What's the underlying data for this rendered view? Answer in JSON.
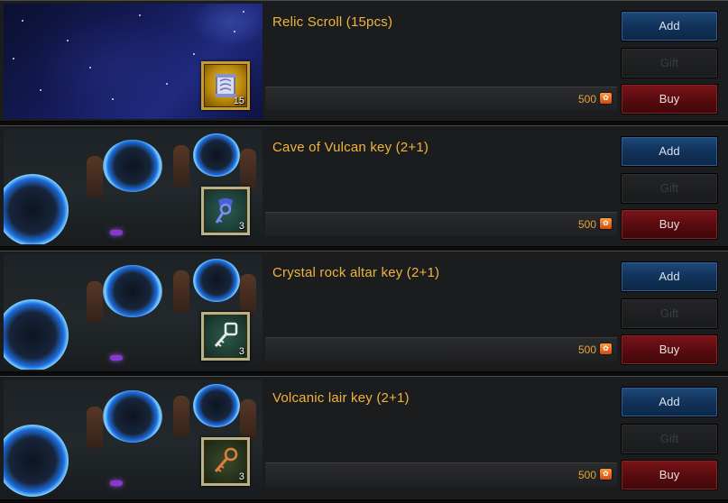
{
  "items": [
    {
      "name": "Relic Scroll (15pcs)",
      "quantity": "15",
      "price": "500",
      "add_label": "Add",
      "gift_label": "Gift",
      "buy_label": "Buy",
      "icon": "relic-scroll-icon"
    },
    {
      "name": "Cave of Vulcan key (2+1)",
      "quantity": "3",
      "price": "500",
      "add_label": "Add",
      "gift_label": "Gift",
      "buy_label": "Buy",
      "icon": "blue-key-icon"
    },
    {
      "name": "Crystal rock altar key (2+1)",
      "quantity": "3",
      "price": "500",
      "add_label": "Add",
      "gift_label": "Gift",
      "buy_label": "Buy",
      "icon": "silver-key-icon"
    },
    {
      "name": "Volcanic lair key (2+1)",
      "quantity": "3",
      "price": "500",
      "add_label": "Add",
      "gift_label": "Gift",
      "buy_label": "Buy",
      "icon": "bronze-key-icon"
    }
  ],
  "colors": {
    "title": "#f0b43c",
    "price": "#e8a23a",
    "add_button": "#1f4a7a",
    "buy_button": "#7a1418",
    "gift_button_disabled": "#232426",
    "frame_gold": "#c99a2c"
  },
  "currency_icon": "coin-icon"
}
